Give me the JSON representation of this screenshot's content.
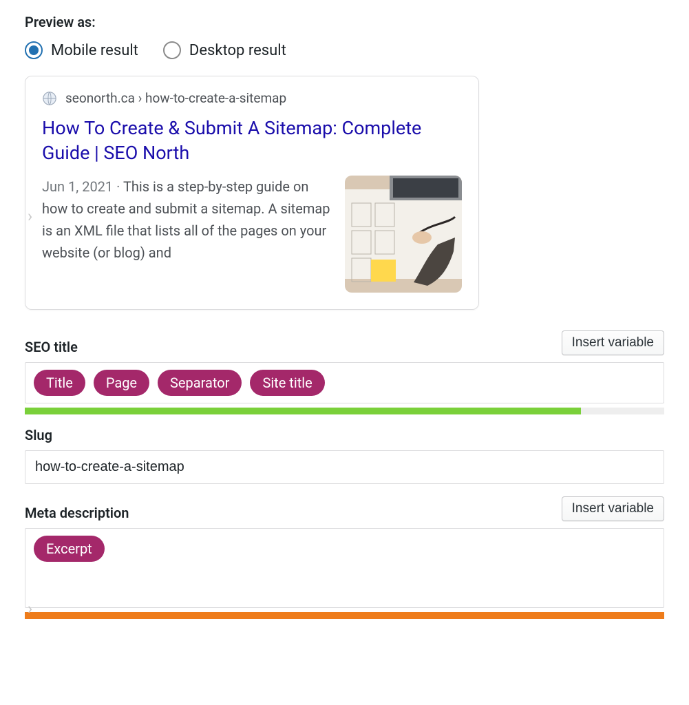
{
  "preview_as": {
    "label": "Preview as:",
    "options": [
      {
        "label": "Mobile result",
        "selected": true
      },
      {
        "label": "Desktop result",
        "selected": false
      }
    ]
  },
  "snippet": {
    "breadcrumb": "seonorth.ca › how-to-create-a-sitemap",
    "title": "How To Create & Submit A Sitemap: Complete Guide | SEO North",
    "date": "Jun 1, 2021",
    "description": "This is a step-by-step guide on how to create and submit a sitemap. A sitemap is an XML file that lists all of the pages on your website (or blog) and"
  },
  "seo_title": {
    "label": "SEO title",
    "insert_button": "Insert variable",
    "tokens": [
      "Title",
      "Page",
      "Separator",
      "Site title"
    ],
    "progress_percent": 87,
    "progress_color": "#7ad03a"
  },
  "slug": {
    "label": "Slug",
    "value": "how-to-create-a-sitemap"
  },
  "meta_description": {
    "label": "Meta description",
    "insert_button": "Insert variable",
    "tokens": [
      "Excerpt"
    ],
    "progress_percent": 100,
    "progress_color": "#ee7c1b"
  }
}
